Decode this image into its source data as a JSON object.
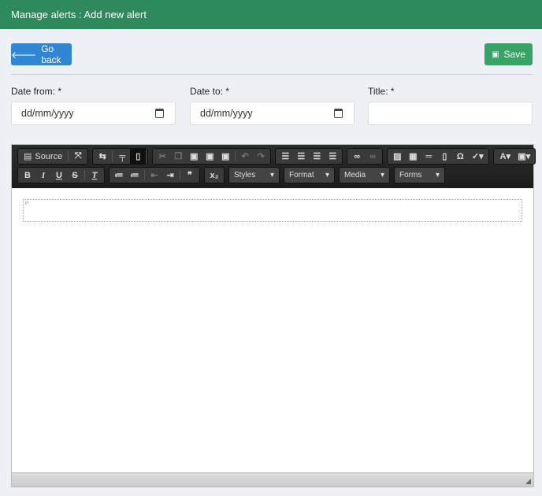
{
  "header": {
    "title": "Manage alerts : Add new alert"
  },
  "toolbar": {
    "go_back": "Go back",
    "save": "Save"
  },
  "form": {
    "date_from": {
      "label": "Date from: *",
      "placeholder": "dd/mm/yyyy"
    },
    "date_to": {
      "label": "Date to: *",
      "placeholder": "dd/mm/yyyy"
    },
    "title": {
      "label": "Title: *",
      "value": ""
    }
  },
  "editor": {
    "source_label": "Source",
    "combos": [
      "Styles",
      "Format",
      "Media",
      "Forms"
    ],
    "paragraph_tag": "P"
  },
  "colors": {
    "header": "#2e8a5c",
    "go_back": "#2f86d4",
    "save": "#36a465"
  }
}
